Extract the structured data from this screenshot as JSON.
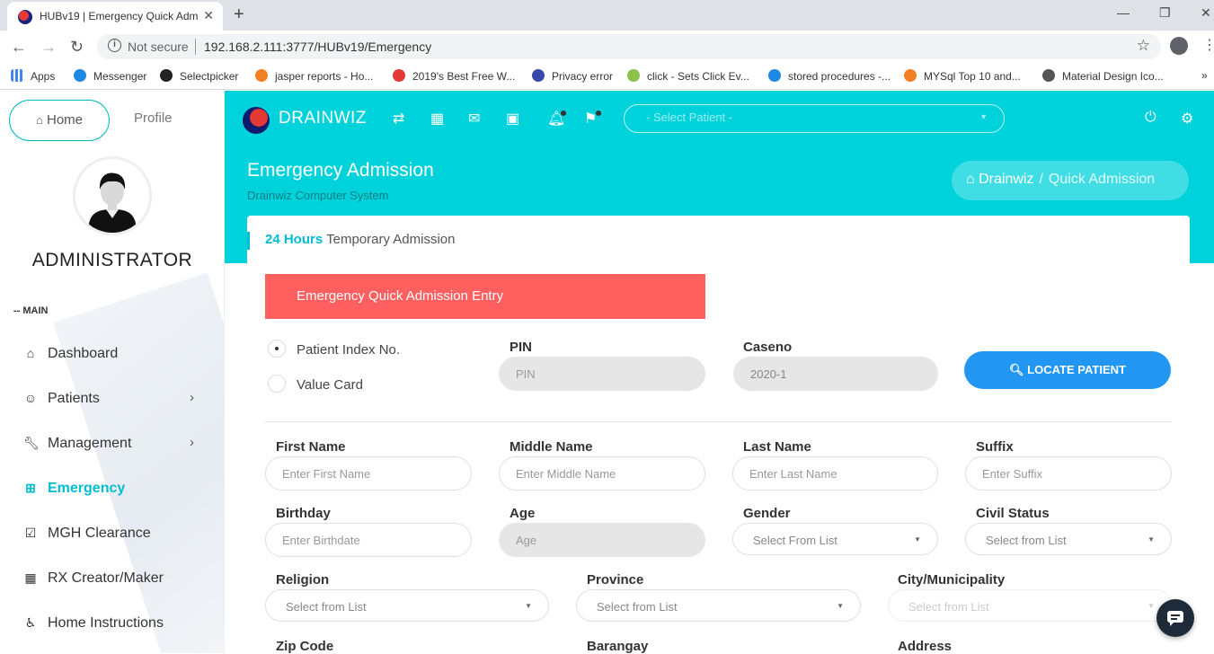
{
  "browser": {
    "tab_title": "HUBv19 | Emergency Quick Adm",
    "not_secure": "Not secure",
    "url": "192.168.2.111:3777/HUBv19/Emergency",
    "bookmarks": [
      {
        "label": "Apps",
        "icon": "apps-grid-icon",
        "color": "#4285f4"
      },
      {
        "label": "Messenger",
        "icon": "messenger-icon",
        "color": "#1e88e5"
      },
      {
        "label": "Selectpicker",
        "icon": "github-icon",
        "color": "#222222"
      },
      {
        "label": "jasper reports - Ho...",
        "icon": "stackoverflow-icon",
        "color": "#f48024"
      },
      {
        "label": "2019's Best Free W...",
        "icon": "site-icon",
        "color": "#e53935"
      },
      {
        "label": "Privacy error",
        "icon": "globe-icon",
        "color": "#3949ab"
      },
      {
        "label": "click - Sets Click Ev...",
        "icon": "spark-icon",
        "color": "#8bc34a"
      },
      {
        "label": "stored procedures -...",
        "icon": "db-icon",
        "color": "#1e88e5"
      },
      {
        "label": "MYSql Top 10 and...",
        "icon": "stackoverflow-icon",
        "color": "#f48024"
      },
      {
        "label": "Material Design Ico...",
        "icon": "globe-icon",
        "color": "#555555"
      }
    ]
  },
  "sidebar": {
    "home_label": "Home",
    "profile_label": "Profile",
    "user_name": "ADMINISTRATOR",
    "section_label": "-- MAIN",
    "items": [
      {
        "label": "Dashboard",
        "icon": "home-icon",
        "chevron": false,
        "active": false
      },
      {
        "label": "Patients",
        "icon": "smile-icon",
        "chevron": true,
        "active": false
      },
      {
        "label": "Management",
        "icon": "wrench-icon",
        "chevron": true,
        "active": false
      },
      {
        "label": "Emergency",
        "icon": "plus-square-icon",
        "chevron": false,
        "active": true
      },
      {
        "label": "MGH Clearance",
        "icon": "check-square-icon",
        "chevron": false,
        "active": false
      },
      {
        "label": "RX Creator/Maker",
        "icon": "grid-icon",
        "chevron": false,
        "active": false
      },
      {
        "label": "Home Instructions",
        "icon": "wheelchair-icon",
        "chevron": false,
        "active": false
      }
    ]
  },
  "header": {
    "brand": "DRAINWIZ",
    "patient_select_placeholder": "- Select Patient -",
    "page_title": "Emergency Admission",
    "page_subtitle": "Drainwiz Computer System",
    "breadcrumb_home": "Drainwiz",
    "breadcrumb_current": "Quick Admission",
    "accent": "#00d2dc"
  },
  "card": {
    "title_bold": "24 Hours",
    "title_rest": "Temporary Admission",
    "banner": "Emergency Quick Admission Entry",
    "banner_color": "#ff5f5f",
    "radio_patient_index": "Patient Index No.",
    "radio_value_card": "Value Card",
    "pin_label": "PIN",
    "pin_placeholder": "PIN",
    "caseno_label": "Caseno",
    "caseno_value": "2020-1",
    "locate_button": "LOCATE PATIENT",
    "first_name_label": "First Name",
    "first_name_placeholder": "Enter First Name",
    "middle_name_label": "Middle Name",
    "middle_name_placeholder": "Enter Middle Name",
    "last_name_label": "Last Name",
    "last_name_placeholder": "Enter Last Name",
    "suffix_label": "Suffix",
    "suffix_placeholder": "Enter Suffix",
    "birthday_label": "Birthday",
    "birthday_placeholder": "Enter Birthdate",
    "age_label": "Age",
    "age_placeholder": "Age",
    "gender_label": "Gender",
    "gender_value": "Select From List",
    "civil_status_label": "Civil Status",
    "civil_status_value": "Select from List",
    "religion_label": "Religion",
    "religion_value": "Select from List",
    "province_label": "Province",
    "province_value": "Select from List",
    "city_label": "City/Municipality",
    "city_value": "Select from List",
    "zip_label": "Zip Code",
    "barangay_label": "Barangay",
    "address_label": "Address"
  }
}
